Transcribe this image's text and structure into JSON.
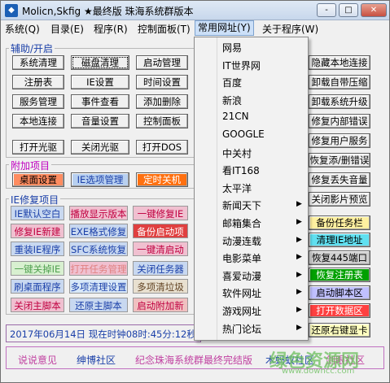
{
  "window": {
    "title": "Molicn,Skfig ★最终版 珠海系统群版本",
    "minimize": "-",
    "maximize": "□",
    "close": "✕"
  },
  "menubar": [
    "系统(Q)",
    "目录(E)",
    "程序(R)",
    "控制面板(T)",
    "常用网址(Y)",
    "关于程序(W)"
  ],
  "groups": {
    "assist": "辅助/开启",
    "extra": "附加项目",
    "ie_repair": "IE修复项目"
  },
  "assist_buttons": [
    [
      "系统清理",
      "磁盘清理",
      "启动管理"
    ],
    [
      "注册表",
      "IE设置",
      "时间设置"
    ],
    [
      "服务管理",
      "事件查看",
      "添加删除"
    ],
    [
      "本地连接",
      "音量设置",
      "控制面板"
    ],
    [
      "打开光驱",
      "关闭光驱",
      "打开DOS"
    ]
  ],
  "extra_buttons": [
    "桌面设置",
    "IE选项管理",
    "定时关机"
  ],
  "ie_buttons": [
    [
      "IE默认空白",
      "播放显示版本",
      "一键修复IE"
    ],
    [
      "修复IE新建",
      "EXE格式修复",
      "备份启动项"
    ],
    [
      "重装IE程序",
      "SFC系统恢复",
      "一键清启动"
    ],
    [
      "一键关掉IE",
      "打开任务管理",
      "关闭任务器"
    ],
    [
      "刷桌面程序",
      "多项清理设置",
      "多项清垃圾"
    ],
    [
      "关闭主脚本",
      "还原主脚本",
      "启动附加新"
    ]
  ],
  "right_buttons": [
    "隐藏本地连接",
    "卸载自带压缩",
    "卸载系统升级",
    "修复内部错误",
    "修复用户服务",
    "恢复添/删错误",
    "修复丢失音量",
    "关闭影片预览",
    "备份任务栏",
    "清理IE地址",
    "恢复445端口",
    "恢复注册表",
    "启动脚本区",
    "打开数据区",
    "还原右键显卡"
  ],
  "dropdown_items": [
    {
      "label": "网易",
      "submenu": false
    },
    {
      "label": "IT世界网",
      "submenu": false
    },
    {
      "label": "百度",
      "submenu": false
    },
    {
      "label": "新浪",
      "submenu": false
    },
    {
      "label": "21CN",
      "submenu": false
    },
    {
      "label": "GOOGLE",
      "submenu": false
    },
    {
      "label": "中关村",
      "submenu": false
    },
    {
      "label": "看IT168",
      "submenu": false
    },
    {
      "label": "太平洋",
      "submenu": false
    },
    {
      "label": "新闻天下",
      "submenu": true
    },
    {
      "label": "邮箱集合",
      "submenu": true
    },
    {
      "label": "动漫连载",
      "submenu": true
    },
    {
      "label": "电影菜单",
      "submenu": true
    },
    {
      "label": "喜爱动漫",
      "submenu": true
    },
    {
      "label": "软件网址",
      "submenu": true
    },
    {
      "label": "游戏网址",
      "submenu": true
    },
    {
      "label": "热门论坛",
      "submenu": true
    }
  ],
  "status": "2017年06月14日 现在时钟08时:45分:12秒",
  "bottom_links": [
    "说说意见",
    "绅博社区",
    "纪念珠海系统群最终完结版",
    "木蚂蚁社区",
    "剑眼社区"
  ],
  "watermark": {
    "text": "绿色资源网",
    "url": "www.downcc.com"
  },
  "colors": {
    "accent": "#cce0f8",
    "purple": "#9a6aa8",
    "pink": "#c070c0"
  }
}
